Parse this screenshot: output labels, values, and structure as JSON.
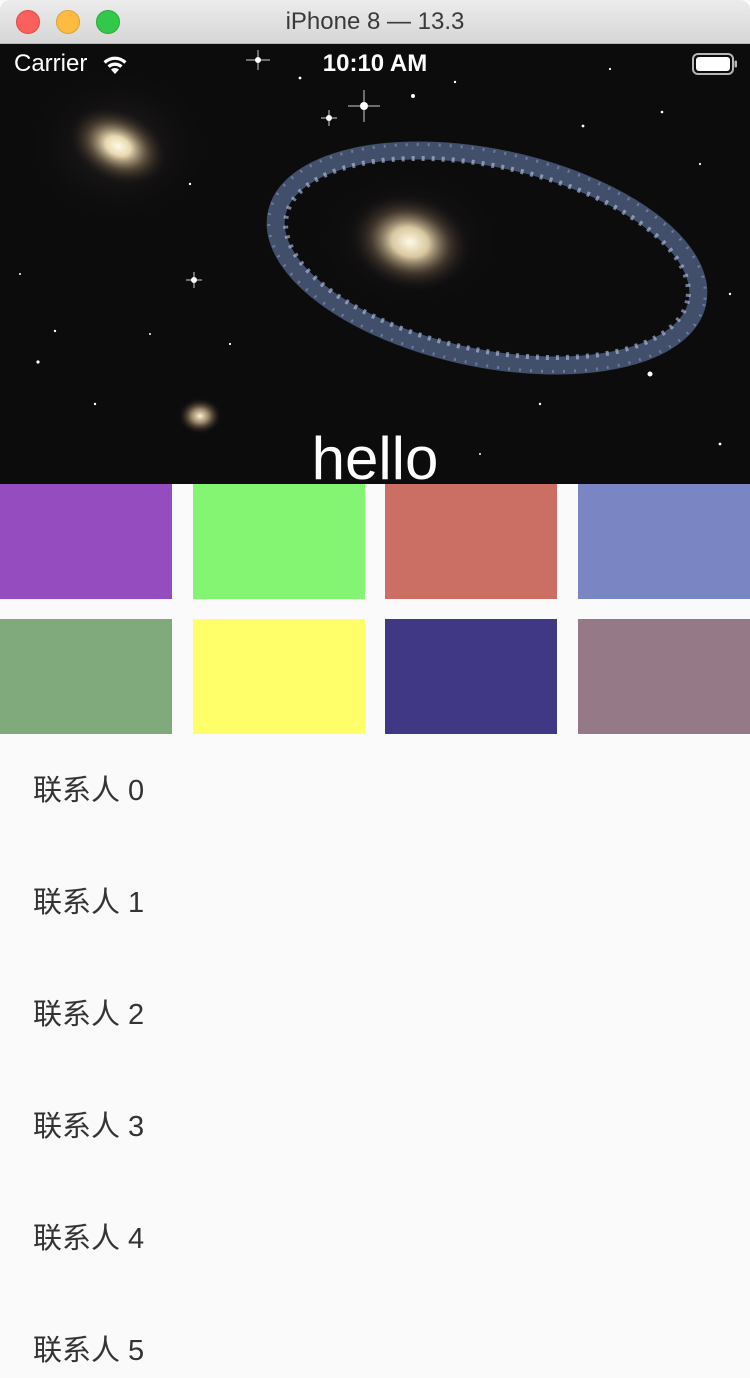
{
  "window": {
    "title": "iPhone 8 — 13.3"
  },
  "status_bar": {
    "carrier": "Carrier",
    "time": "10:10 AM"
  },
  "header": {
    "title": "hello"
  },
  "color_tiles": [
    {
      "color": "#954cbe"
    },
    {
      "color": "#83f572"
    },
    {
      "color": "#cb6f65"
    },
    {
      "color": "#7986c3"
    },
    {
      "color": "#80a97c"
    },
    {
      "color": "#ffff69"
    },
    {
      "color": "#403885"
    },
    {
      "color": "#957987"
    }
  ],
  "contacts": [
    {
      "label": "联系人 0"
    },
    {
      "label": "联系人 1"
    },
    {
      "label": "联系人 2"
    },
    {
      "label": "联系人 3"
    },
    {
      "label": "联系人 4"
    },
    {
      "label": "联系人 5"
    }
  ]
}
